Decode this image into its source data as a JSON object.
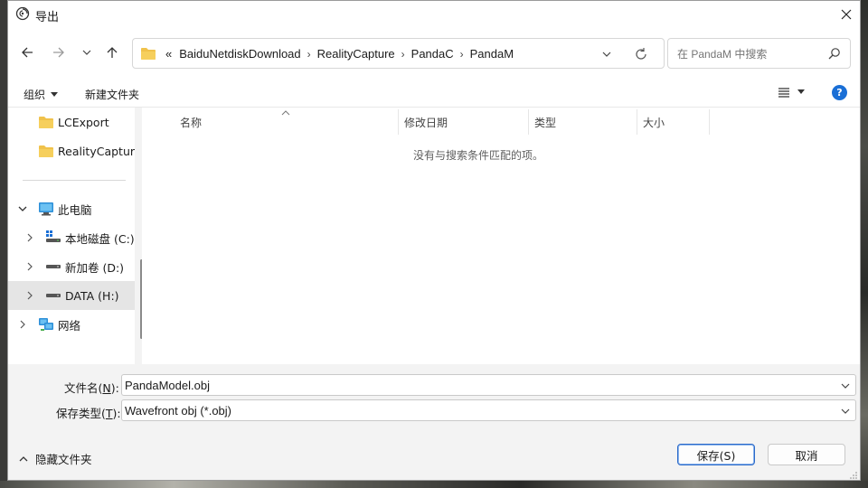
{
  "window": {
    "title": "导出",
    "close_label": "✕"
  },
  "address": {
    "overflow": "«",
    "crumbs": [
      "BaiduNetdiskDownload",
      "RealityCapture",
      "PandaC",
      "PandaM"
    ],
    "separator": "›"
  },
  "search": {
    "placeholder": "在 PandaM 中搜索"
  },
  "toolbar": {
    "organize_label": "组织",
    "new_folder_label": "新建文件夹"
  },
  "nav_pane": {
    "items": [
      {
        "label": "LCExport",
        "icon": "folder-icon"
      },
      {
        "label": "RealityCapture",
        "icon": "folder-icon"
      },
      {
        "label": "此电脑",
        "icon": "computer-icon"
      },
      {
        "label": "本地磁盘 (C:)",
        "icon": "windows-drive-icon"
      },
      {
        "label": "新加卷 (D:)",
        "icon": "drive-icon"
      },
      {
        "label": "DATA (H:)",
        "icon": "drive-icon"
      },
      {
        "label": "网络",
        "icon": "network-icon"
      }
    ]
  },
  "file_list": {
    "columns": [
      "名称",
      "修改日期",
      "类型",
      "大小"
    ],
    "empty_message": "没有与搜索条件匹配的项。"
  },
  "filename": {
    "label": "文件名(N):",
    "label_main": "文件名(",
    "label_key": "N",
    "label_end": "):",
    "value": "PandaModel.obj"
  },
  "filetype": {
    "label_main": "保存类型(",
    "label_key": "T",
    "label_end": "):",
    "value": "Wavefront obj (*.obj)"
  },
  "footer": {
    "hide_folders_label": "隐藏文件夹",
    "save_label": "保存(S)",
    "cancel_label": "取消"
  },
  "colors": {
    "accent": "#1a6fd6",
    "folder": "#f0c24b",
    "selected_bg": "#e5e5e5"
  }
}
